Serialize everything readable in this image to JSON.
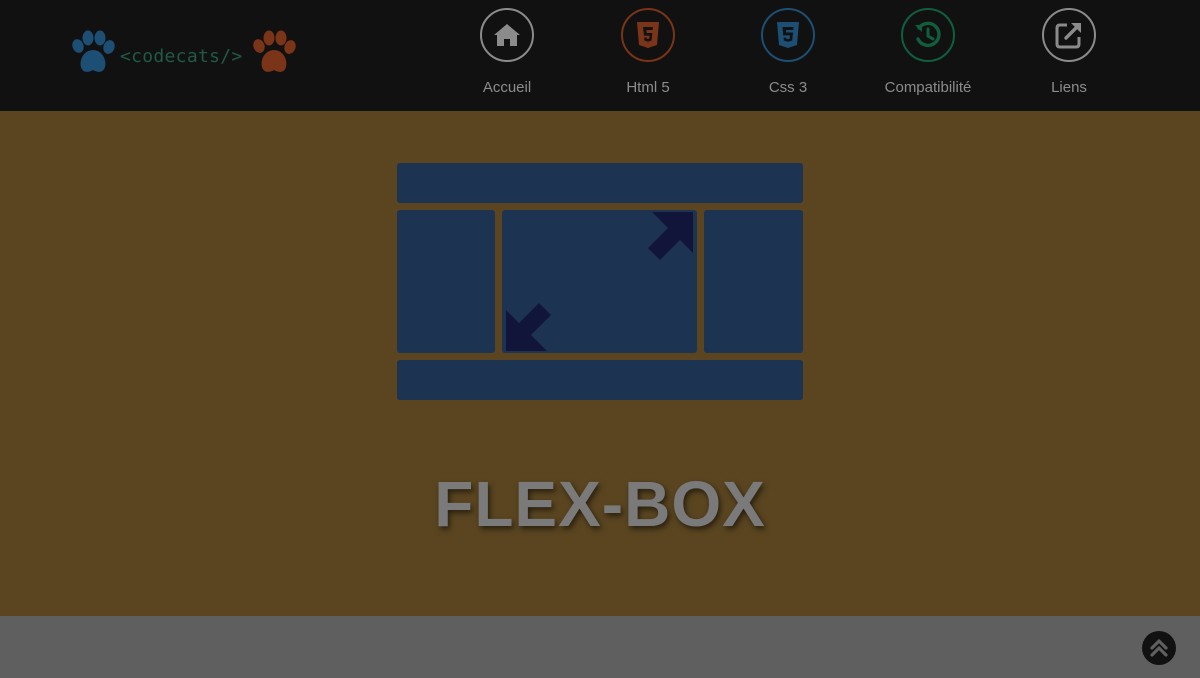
{
  "header": {
    "logo": {
      "text": "<codecats/>",
      "left_paw_icon": "paw-icon",
      "right_paw_icon": "paw-icon",
      "colors": {
        "left_paw": "#1c4f73",
        "right_paw": "#7a3417",
        "text": "#1f5a45"
      }
    },
    "nav": [
      {
        "label": "Accueil",
        "icon": "home-icon",
        "color": "#8b8b8b"
      },
      {
        "label": "Html 5",
        "icon": "html5-icon",
        "color": "#7a3417"
      },
      {
        "label": "Css 3",
        "icon": "css3-icon",
        "color": "#1c4f73"
      },
      {
        "label": "Compatibilité",
        "icon": "history-icon",
        "color": "#0f5f3f"
      },
      {
        "label": "Liens",
        "icon": "external-link-icon",
        "color": "#8b8b8b"
      }
    ]
  },
  "hero": {
    "illustration_icon": "flexbox-layout-icon",
    "title": "FLEX-BOX",
    "colors": {
      "background": "#5a4520",
      "blocks": "#1d3352",
      "arrows": "#12153a",
      "title": "#7a7a7a"
    }
  },
  "footer": {
    "scroll_top_icon": "chevron-up-icon"
  }
}
